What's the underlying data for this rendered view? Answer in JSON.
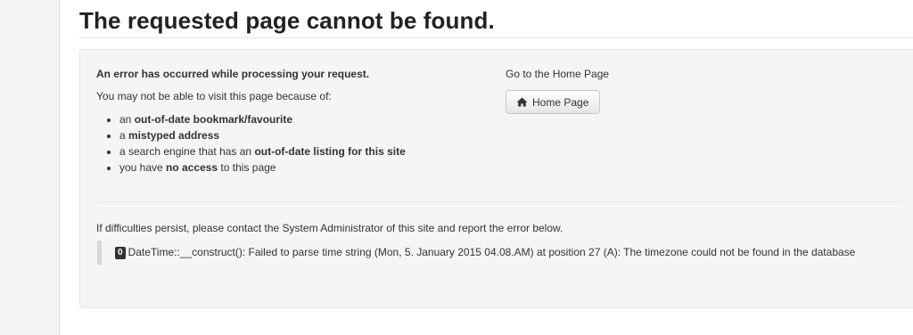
{
  "page": {
    "title": "The requested page cannot be found."
  },
  "error": {
    "heading": "An error has occurred while processing your request.",
    "intro": "You may not be able to visit this page because of:",
    "reasons": [
      {
        "before": "an ",
        "bold": "out-of-date bookmark/favourite",
        "after": ""
      },
      {
        "before": "a ",
        "bold": "mistyped address",
        "after": ""
      },
      {
        "before": "a search engine that has an ",
        "bold": "out-of-date listing for this site",
        "after": ""
      },
      {
        "before": "you have ",
        "bold": "no access",
        "after": " to this page"
      }
    ],
    "contact_text": "If difficulties persist, please contact the System Administrator of this site and report the error below.",
    "code": "0",
    "message": "DateTime::__construct(): Failed to parse time string (Mon, 5. January 2015 04.08.AM) at position 27 (A): The timezone could not be found in the database"
  },
  "home": {
    "label": "Go to the Home Page",
    "button_label": "Home Page",
    "icon": "home-icon"
  }
}
